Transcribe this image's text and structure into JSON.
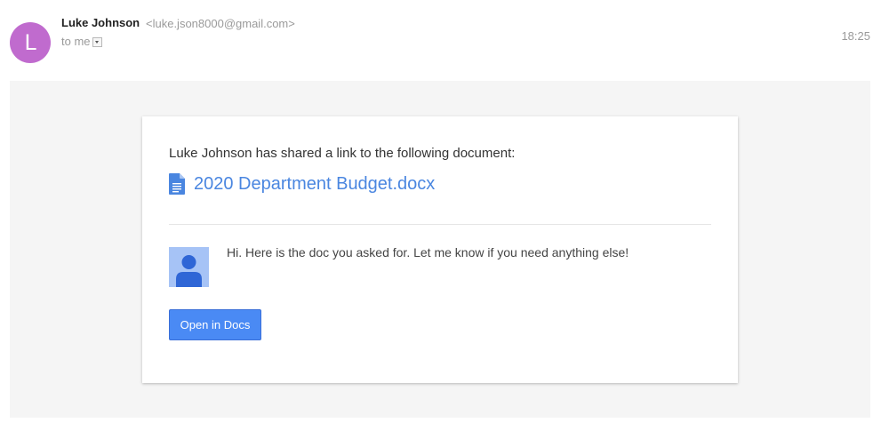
{
  "header": {
    "avatar_letter": "L",
    "sender_name": "Luke Johnson",
    "sender_email": "<luke.json8000@gmail.com>",
    "recipient_label": "to me",
    "timestamp": "18:25"
  },
  "card": {
    "share_text": "Luke Johnson has shared a link to the following document:",
    "document_title": "2020 Department Budget.docx",
    "message": "Hi. Here is the doc you asked for. Let me know if you need anything else!",
    "button_label": "Open in Docs"
  },
  "colors": {
    "avatar_bg": "#c06bce",
    "link": "#4a86e0",
    "button_bg": "#4a8af4",
    "doc_icon": "#4a86e0"
  },
  "icons": {
    "document": "docs-document-icon",
    "profile": "user-profile-icon",
    "dropdown": "chevron-down-icon"
  }
}
